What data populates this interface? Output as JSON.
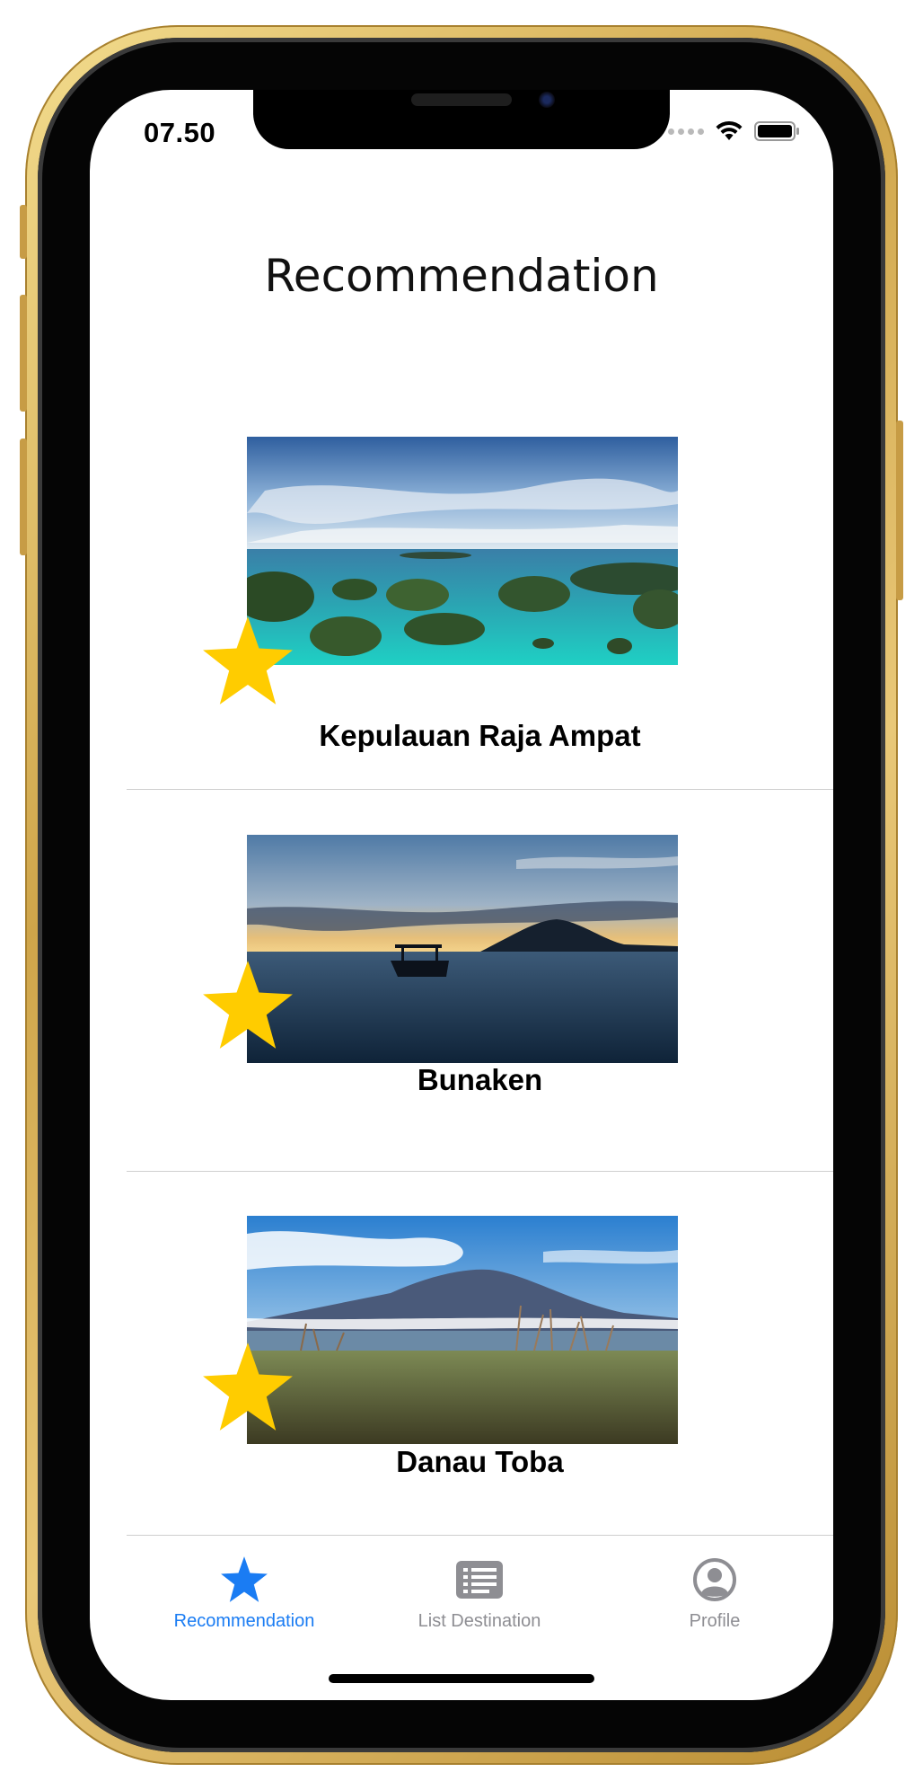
{
  "status_bar": {
    "time": "07.50"
  },
  "header": {
    "title": "Recommendation"
  },
  "destinations": [
    {
      "name": "Kepulauan Raja Ampat",
      "photo": "tropical-islands-photo",
      "favorite": true
    },
    {
      "name": "Bunaken",
      "photo": "sunset-boat-sea-photo",
      "favorite": true
    },
    {
      "name": "Danau Toba",
      "photo": "mountain-lake-photo",
      "favorite": true
    }
  ],
  "tab_bar": {
    "items": [
      {
        "label": "Recommendation",
        "icon": "star-icon",
        "active": true
      },
      {
        "label": "List Destination",
        "icon": "list-icon",
        "active": false
      },
      {
        "label": "Profile",
        "icon": "person-circle-icon",
        "active": false
      }
    ]
  },
  "colors": {
    "accent": "#1a7cf3",
    "star": "#ffcc00",
    "inactive_tab": "#8e8e93",
    "device_frame": "#d4ab52"
  }
}
